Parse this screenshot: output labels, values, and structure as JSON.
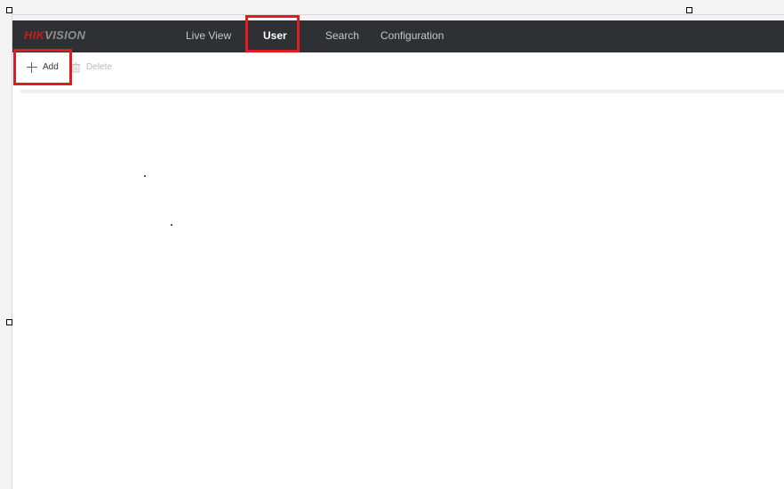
{
  "brand": {
    "part1": "HIK",
    "part2": "VISION"
  },
  "nav": {
    "items": [
      {
        "label": "Live View"
      },
      {
        "label": "User"
      },
      {
        "label": "Search"
      },
      {
        "label": "Configuration"
      }
    ],
    "active": "User"
  },
  "toolbar": {
    "add_label": "Add",
    "delete_label": "Delete"
  },
  "colors": {
    "nav_bg": "#2f3033",
    "highlight": "#e11b22",
    "logo_red": "#d0191a",
    "logo_gray": "#8f8f8f"
  }
}
